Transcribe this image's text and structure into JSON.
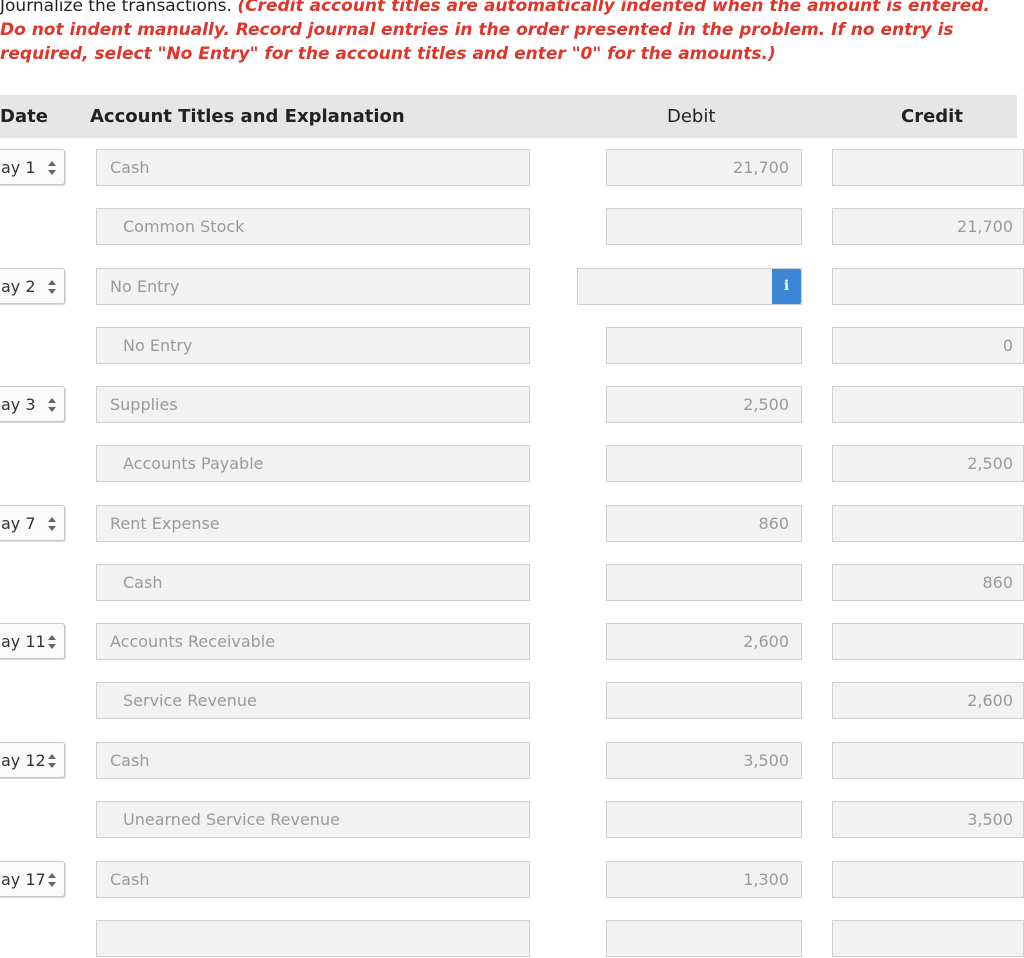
{
  "instructions": {
    "lead": "Journalize the transactions.",
    "emphasis": "(Credit account titles are automatically indented when the amount is entered. Do not indent manually. Record journal entries in the order presented in the problem. If no entry is required, select \"No Entry\" for the account titles and enter \"0\" for the amounts.)"
  },
  "table": {
    "headers": {
      "date": "Date",
      "account": "Account Titles and Explanation",
      "debit": "Debit",
      "credit": "Credit"
    },
    "rows": [
      {
        "date": "ay 1",
        "account": "Cash",
        "debit": "21,700",
        "credit": ""
      },
      {
        "date": "",
        "account": "Common Stock",
        "debit": "",
        "credit": "21,700"
      },
      {
        "date": "ay 2",
        "account": "No Entry",
        "debit": "",
        "credit": ""
      },
      {
        "date": "",
        "account": "No Entry",
        "debit": "",
        "credit": "0"
      },
      {
        "date": "ay 3",
        "account": "Supplies",
        "debit": "2,500",
        "credit": ""
      },
      {
        "date": "",
        "account": "Accounts Payable",
        "debit": "",
        "credit": "2,500"
      },
      {
        "date": "ay 7",
        "account": "Rent Expense",
        "debit": "860",
        "credit": ""
      },
      {
        "date": "",
        "account": "Cash",
        "debit": "",
        "credit": "860"
      },
      {
        "date": "ay 11",
        "account": "Accounts Receivable",
        "debit": "2,600",
        "credit": ""
      },
      {
        "date": "",
        "account": "Service Revenue",
        "debit": "",
        "credit": "2,600"
      },
      {
        "date": "ay 12",
        "account": "Cash",
        "debit": "3,500",
        "credit": ""
      },
      {
        "date": "",
        "account": "Unearned Service Revenue",
        "debit": "",
        "credit": "3,500"
      },
      {
        "date": "ay 17",
        "account": "Cash",
        "debit": "1,300",
        "credit": ""
      }
    ]
  },
  "info_icon": {
    "name": "info-icon",
    "glyph": "i",
    "color": "#3b86d6"
  },
  "colors": {
    "instruction_red": "#e0352b",
    "header_bg": "#e6e6e6",
    "field_bg": "#f2f2f2"
  }
}
